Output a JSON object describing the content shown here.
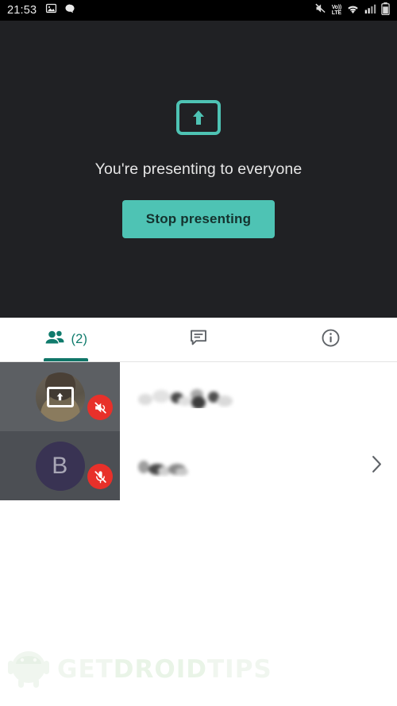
{
  "statusbar": {
    "time": "21:53",
    "left_icons": [
      "image-icon",
      "chat-bubble-icon"
    ],
    "right_icons": [
      "ringer-off-icon",
      "volte-icon",
      "wifi-icon",
      "signal-icon",
      "battery-icon"
    ],
    "volte_top": "Vo))",
    "volte_bottom": "LTE",
    "background": "#000000",
    "foreground": "#e9e9e9"
  },
  "stage": {
    "icon": "present-to-all-icon",
    "message": "You're presenting to everyone",
    "stop_button": "Stop presenting",
    "background": "#202124",
    "accent": "#4ec3b4",
    "button_text_color": "#14322e"
  },
  "tabs": [
    {
      "name": "people",
      "icon": "people-icon",
      "label": "(2)",
      "active": true,
      "color": "#0f7b6c"
    },
    {
      "name": "chat",
      "icon": "chat-icon",
      "label": "",
      "active": false,
      "color": "#5f6368"
    },
    {
      "name": "info",
      "icon": "info-icon",
      "label": "",
      "active": false,
      "color": "#5f6368"
    }
  ],
  "participants": [
    {
      "avatar_type": "photo",
      "avatar_letter": "",
      "thumb_background": "#5c5f63",
      "presenting_overlay": "present-to-all-icon",
      "badge_icon": "volume-off-icon",
      "badge_color": "#e8302a",
      "name": "",
      "name_redacted": true,
      "has_chevron": false
    },
    {
      "avatar_type": "letter",
      "avatar_letter": "B",
      "thumb_background": "#4c4f54",
      "presenting_overlay": "",
      "badge_icon": "mic-off-icon",
      "badge_color": "#e8302a",
      "name": "",
      "name_redacted": true,
      "has_chevron": true
    }
  ],
  "watermark": {
    "logo": "android-robot-icon",
    "text_part1": "GET",
    "text_part2": "DROID",
    "text_part3": "TIPS",
    "color": "#cfe3cc"
  }
}
